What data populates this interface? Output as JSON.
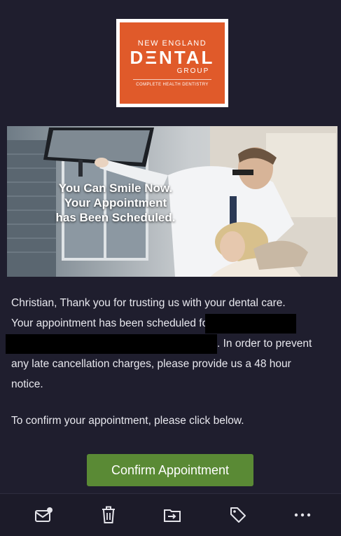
{
  "logo": {
    "line1": "NEW ENGLAND",
    "line2": "DΞNTAL",
    "line3": "GROUP",
    "tagline": "COMPLETE HEALTH DENTISTRY",
    "color": "#e05a2a"
  },
  "hero": {
    "line1": "You Can Smile Now.",
    "line2": "Your Appointment",
    "line3": "has Been Scheduled."
  },
  "message": {
    "line1": "Christian, Thank you for trusting us with your dental care.",
    "line2_start": "Your appointment has been scheduled fo",
    "line3_end": ". In order to prevent",
    "line4": "any late cancellation charges, please provide us a 48 hour",
    "line5": "notice.",
    "confirm_prompt": "To confirm your appointment, please click below."
  },
  "button": {
    "label": "Confirm Appointment",
    "color": "#5a8a35"
  },
  "toolbar": {
    "icons": [
      "mark-unread-icon",
      "trash-icon",
      "move-to-folder-icon",
      "tag-icon",
      "more-icon"
    ]
  }
}
